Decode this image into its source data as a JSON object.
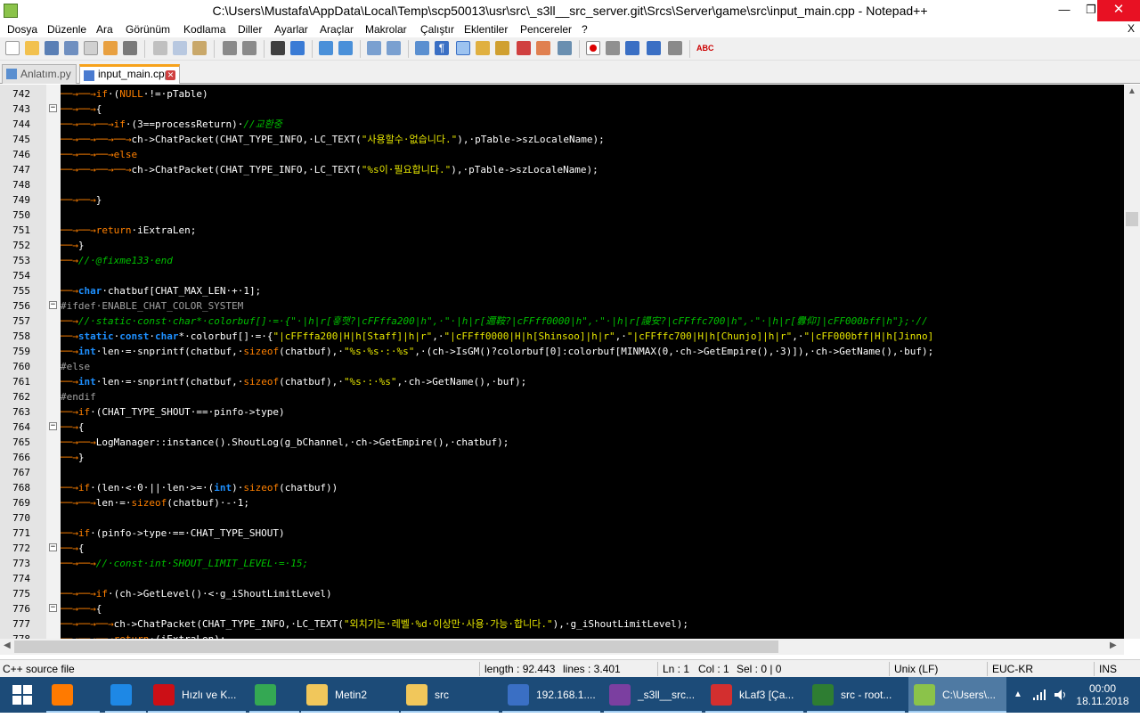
{
  "window": {
    "title": "C:\\Users\\Mustafa\\AppData\\Local\\Temp\\scp50013\\usr\\src\\_s3ll__src_server.git\\Srcs\\Server\\game\\src\\input_main.cpp - Notepad++",
    "min": "—",
    "max": "❐",
    "close": "✕"
  },
  "menu": {
    "items": [
      "Dosya",
      "Düzenle",
      "Ara",
      "Görünüm",
      "Kodlama",
      "Diller",
      "Ayarlar",
      "Araçlar",
      "Makrolar",
      "Çalıştır",
      "Eklentiler",
      "Pencereler",
      "?"
    ],
    "close": "X"
  },
  "tabs": [
    {
      "label": "Anlatım.py",
      "active": false
    },
    {
      "label": "input_main.cpp",
      "active": true
    }
  ],
  "editor": {
    "lines": [
      {
        "n": "742",
        "fold": "",
        "html": "<span class='ar'>──→──→</span><span class='kw'>if</span>·(<span class='kw'>NULL</span>·!=·pTable)"
      },
      {
        "n": "743",
        "fold": "−",
        "html": "<span class='ar'>──→──→</span>{"
      },
      {
        "n": "744",
        "fold": "",
        "html": "<span class='ar'>──→──→──→</span><span class='kw'>if</span>·(3==processReturn)·<span class='cm'>//교환중</span>"
      },
      {
        "n": "745",
        "fold": "",
        "html": "<span class='ar'>──→──→──→──→</span>ch-&gt;ChatPacket(CHAT_TYPE_INFO,·LC_TEXT(<span class='st'>\"사용할수·없습니다.\"</span>),·pTable-&gt;szLocaleName);"
      },
      {
        "n": "746",
        "fold": "",
        "html": "<span class='ar'>──→──→──→</span><span class='kw'>else</span>"
      },
      {
        "n": "747",
        "fold": "",
        "html": "<span class='ar'>──→──→──→──→</span>ch-&gt;ChatPacket(CHAT_TYPE_INFO,·LC_TEXT(<span class='st'>\"%s이·필요합니다.\"</span>),·pTable-&gt;szLocaleName);"
      },
      {
        "n": "748",
        "fold": "",
        "html": ""
      },
      {
        "n": "749",
        "fold": "",
        "html": "<span class='ar'>──→──→</span>}"
      },
      {
        "n": "750",
        "fold": "",
        "html": ""
      },
      {
        "n": "751",
        "fold": "",
        "html": "<span class='ar'>──→──→</span><span class='kw'>return</span>·iExtraLen;"
      },
      {
        "n": "752",
        "fold": "",
        "html": "<span class='ar'>──→</span>}"
      },
      {
        "n": "753",
        "fold": "",
        "html": "<span class='ar'>──→</span><span class='cm'>//·@fixme133·end</span>"
      },
      {
        "n": "754",
        "fold": "",
        "html": ""
      },
      {
        "n": "755",
        "fold": "",
        "html": "<span class='ar'>──→</span><span class='ty'>char</span>·chatbuf[CHAT_MAX_LEN·+·1];"
      },
      {
        "n": "756",
        "fold": "−",
        "html": "<span class='pp'>#ifdef·ENABLE_CHAT_COLOR_SYSTEM</span>"
      },
      {
        "n": "757",
        "fold": "",
        "html": "<span class='ar'>──→</span><span class='cm'>//·static·const·char*·colorbuf[]·=·{\"·|h|r[흫햇?|cFFffa200|h\",·\"·|h|r[邇鞍?|cFFff0000|h\",·\"·|h|r[謾安?|cFFffc700|h\",·\"·|h|r[釁仰]|cFF000bff|h\"};·//</span>"
      },
      {
        "n": "758",
        "fold": "",
        "html": "<span class='ar'>──→</span><span class='ty'>static</span>·<span class='ty'>const</span>·<span class='ty'>char</span>*·colorbuf[]·=·{<span class='st'>\"|cFFffa200|H|h[Staff]|h|r\"</span>,·<span class='st'>\"|cFFff0000|H|h[Shinsoo]|h|r\"</span>,·<span class='st'>\"|cFFffc700|H|h[Chunjo]|h|r\"</span>,·<span class='st'>\"|cFF000bff|H|h[Jinno]</span>"
      },
      {
        "n": "759",
        "fold": "",
        "html": "<span class='ar'>──→</span><span class='ty'>int</span>·len·=·snprintf(chatbuf,·<span class='kw'>sizeof</span>(chatbuf),·<span class='st'>\"%s·%s·:·%s\"</span>,·(ch-&gt;IsGM()?colorbuf[0]:colorbuf[MINMAX(0,·ch-&gt;GetEmpire(),·3)]),·ch-&gt;GetName(),·buf);"
      },
      {
        "n": "760",
        "fold": "",
        "html": "<span class='pp'>#else</span>"
      },
      {
        "n": "761",
        "fold": "",
        "html": "<span class='ar'>──→</span><span class='ty'>int</span>·len·=·snprintf(chatbuf,·<span class='kw'>sizeof</span>(chatbuf),·<span class='st'>\"%s·:·%s\"</span>,·ch-&gt;GetName(),·buf);"
      },
      {
        "n": "762",
        "fold": "",
        "html": "<span class='pp'>#endif</span>"
      },
      {
        "n": "763",
        "fold": "",
        "html": "<span class='ar'>──→</span><span class='kw'>if</span>·(CHAT_TYPE_SHOUT·==·pinfo-&gt;type)"
      },
      {
        "n": "764",
        "fold": "−",
        "html": "<span class='ar'>──→</span>{"
      },
      {
        "n": "765",
        "fold": "",
        "html": "<span class='ar'>──→──→</span>LogManager::instance().ShoutLog(g_bChannel,·ch-&gt;GetEmpire(),·chatbuf);"
      },
      {
        "n": "766",
        "fold": "",
        "html": "<span class='ar'>──→</span>}"
      },
      {
        "n": "767",
        "fold": "",
        "html": ""
      },
      {
        "n": "768",
        "fold": "",
        "html": "<span class='ar'>──→</span><span class='kw'>if</span>·(len·&lt;·0·||·len·&gt;=·(<span class='ty'>int</span>)·<span class='kw'>sizeof</span>(chatbuf))"
      },
      {
        "n": "769",
        "fold": "",
        "html": "<span class='ar'>──→──→</span>len·=·<span class='kw'>sizeof</span>(chatbuf)·-·1;"
      },
      {
        "n": "770",
        "fold": "",
        "html": ""
      },
      {
        "n": "771",
        "fold": "",
        "html": "<span class='ar'>──→</span><span class='kw'>if</span>·(pinfo-&gt;type·==·CHAT_TYPE_SHOUT)"
      },
      {
        "n": "772",
        "fold": "−",
        "html": "<span class='ar'>──→</span>{"
      },
      {
        "n": "773",
        "fold": "",
        "html": "<span class='ar'>──→──→</span><span class='cm'>//·const·int·SHOUT_LIMIT_LEVEL·=·15;</span>"
      },
      {
        "n": "774",
        "fold": "",
        "html": ""
      },
      {
        "n": "775",
        "fold": "",
        "html": "<span class='ar'>──→──→</span><span class='kw'>if</span>·(ch-&gt;GetLevel()·&lt;·g_iShoutLimitLevel)"
      },
      {
        "n": "776",
        "fold": "−",
        "html": "<span class='ar'>──→──→</span>{"
      },
      {
        "n": "777",
        "fold": "",
        "html": "<span class='ar'>──→──→──→</span>ch-&gt;ChatPacket(CHAT_TYPE_INFO,·LC_TEXT(<span class='st'>\"외치기는·레벨·%d·이상만·사용·가능·합니다.\"</span>),·g_iShoutLimitLevel);"
      },
      {
        "n": "778",
        "fold": "",
        "html": "<span class='ar'>──→──→──→</span><span class='kw'>return</span>·(iExtraLen);"
      }
    ]
  },
  "status": {
    "filetype": "C++ source file",
    "length": "length : 92.443",
    "lines": "lines : 3.401",
    "ln": "Ln : 1",
    "col": "Col : 1",
    "sel": "Sel : 0 | 0",
    "eol": "Unix (LF)",
    "encoding": "EUC-KR",
    "mode": "INS"
  },
  "taskbar": {
    "items": [
      {
        "label": "",
        "color": "#ff7a00",
        "icon": "firefox-icon"
      },
      {
        "label": "",
        "color": "#1e88e5",
        "icon": "internet-explorer-icon"
      },
      {
        "label": "Hızlı ve K...",
        "color": "#cc0f16",
        "icon": "opera-icon"
      },
      {
        "label": "",
        "color": "#34a853",
        "icon": "chrome-icon"
      },
      {
        "label": "Metin2",
        "color": "#f1c75b",
        "icon": "folder-icon"
      },
      {
        "label": "src",
        "color": "#f1c75b",
        "icon": "folder-icon"
      },
      {
        "label": "192.168.1....",
        "color": "#3a6fc4",
        "icon": "putty-icon"
      },
      {
        "label": "_s3ll__src...",
        "color": "#7b3fa0",
        "icon": "winrar-icon"
      },
      {
        "label": "kLaf3 [Ça...",
        "color": "#d32f2f",
        "icon": "app-icon"
      },
      {
        "label": "src - root...",
        "color": "#2e7d32",
        "icon": "winscp-icon"
      },
      {
        "label": "C:\\Users\\...",
        "color": "#8bc34a",
        "icon": "notepadpp-icon"
      }
    ],
    "time": "00:00",
    "date": "18.11.2018",
    "tray_up": "▲"
  }
}
